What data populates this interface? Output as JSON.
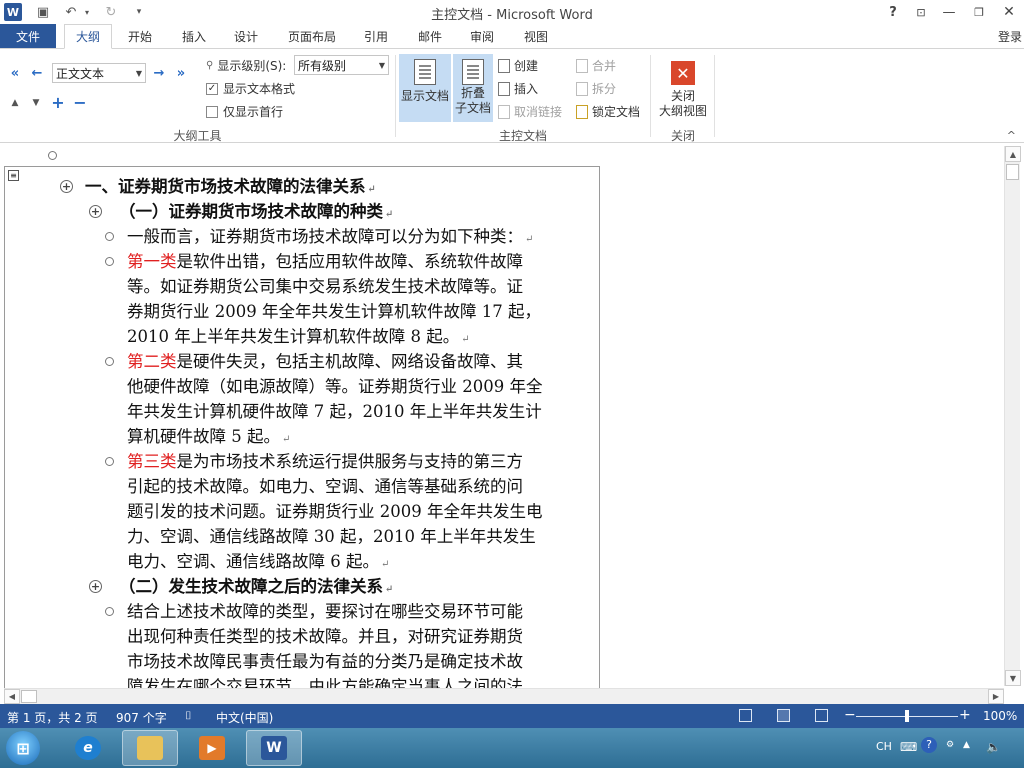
{
  "app": {
    "window_title": "主控文档 - Microsoft Word",
    "app_icon_letter": "W",
    "quick_access": {
      "save": "save",
      "undo": "undo",
      "redo": "redo"
    },
    "help_label": "?",
    "login_label": "登录"
  },
  "tabs": [
    {
      "id": "file",
      "label": "文件"
    },
    {
      "id": "outline",
      "label": "大纲"
    },
    {
      "id": "home",
      "label": "开始"
    },
    {
      "id": "insert",
      "label": "插入"
    },
    {
      "id": "design",
      "label": "设计"
    },
    {
      "id": "layout",
      "label": "页面布局"
    },
    {
      "id": "references",
      "label": "引用"
    },
    {
      "id": "mailings",
      "label": "邮件"
    },
    {
      "id": "review",
      "label": "审阅"
    },
    {
      "id": "view",
      "label": "视图"
    }
  ],
  "ribbon": {
    "outline_tools": {
      "group_label": "大纲工具",
      "level_value": "正文文本",
      "show_level_label": "显示级别(S):",
      "show_level_value": "所有级别",
      "show_text_format_label": "显示文本格式",
      "show_text_format_checked": true,
      "first_line_only_label": "仅显示首行",
      "first_line_only_checked": false
    },
    "master_document": {
      "group_label": "主控文档",
      "show_document_label": "显示文档",
      "collapse_line1": "折叠",
      "collapse_line2": "子文档",
      "create_label": "创建",
      "insert_label": "插入",
      "unlink_label": "取消链接",
      "merge_label": "合并",
      "split_label": "拆分",
      "lock_label": "锁定文档"
    },
    "close": {
      "group_label": "关闭",
      "close_line1": "关闭",
      "close_line2": "大纲视图"
    }
  },
  "document": {
    "lines": [
      {
        "text": "一、证券期货市场技术故障的法律关系",
        "mark": "↵"
      },
      {
        "text": "（一）证券期货市场技术故障的种类",
        "mark": "↵"
      },
      {
        "text": "一般而言，证券期货市场技术故障可以分为如下种类：",
        "mark": "↵"
      },
      {
        "red": "第一类",
        "text": "是软件出错，包括应用软件故障、系统软件故障"
      },
      {
        "text": "等。如证券期货公司集中交易系统发生技术故障等。证"
      },
      {
        "text": "券期货行业 2009 年全年共发生计算机软件故障 17 起，"
      },
      {
        "text": "2010 年上半年共发生计算机软件故障 8 起。",
        "mark": "↵"
      },
      {
        "red": "第二类",
        "text": "是硬件失灵，包括主机故障、网络设备故障、其"
      },
      {
        "text": "他硬件故障（如电源故障）等。证券期货行业 2009 年全"
      },
      {
        "text": "年共发生计算机硬件故障 7 起，2010 年上半年共发生计"
      },
      {
        "text": "算机硬件故障 5 起。",
        "mark": "↵"
      },
      {
        "red": "第三类",
        "text": "是为市场技术系统运行提供服务与支持的第三方"
      },
      {
        "text": "引起的技术故障。如电力、空调、通信等基础系统的问"
      },
      {
        "text": "题引发的技术问题。证券期货行业 2009 年全年共发生电"
      },
      {
        "text": "力、空调、通信线路故障 30 起，2010 年上半年共发生"
      },
      {
        "text": "电力、空调、通信线路故障 6 起。",
        "mark": "↵"
      },
      {
        "text": "（二）发生技术故障之后的法律关系",
        "mark": "↵"
      },
      {
        "text": "结合上述技术故障的类型，要探讨在哪些交易环节可能"
      },
      {
        "text": "出现何种责任类型的技术故障。并且，对研究证券期货"
      },
      {
        "text": "市场技术故障民事责任最为有益的分类乃是确定技术故"
      },
      {
        "text": "障发生在哪个交易环节，由此方能确定当事人之间的法"
      }
    ]
  },
  "status": {
    "page": "第 1 页，共 2 页",
    "words": "907 个字",
    "language": "中文(中国)",
    "zoom": "100%",
    "zoom_minus": "−",
    "zoom_plus": "+",
    "zoom_level": 0.5
  },
  "taskbar": {
    "ime": "CH"
  },
  "colors": {
    "brand": "#2b579a",
    "highlight": "#e02020"
  }
}
